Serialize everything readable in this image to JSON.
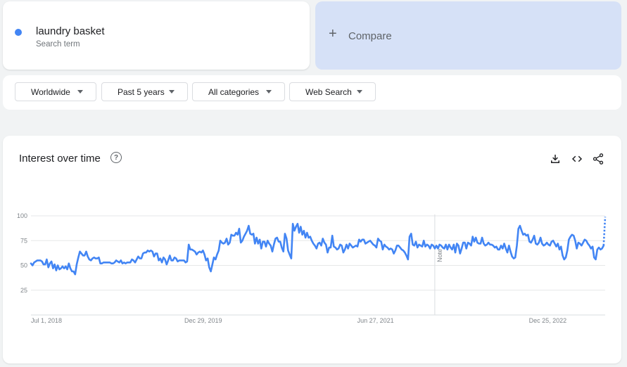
{
  "term": {
    "name": "laundry basket",
    "subtitle": "Search term",
    "color": "#4285f4"
  },
  "compare": {
    "plus": "+",
    "label": "Compare",
    "bg_color": "#d6e1f7"
  },
  "filters": [
    {
      "label": "Worldwide"
    },
    {
      "label": "Past 5 years"
    },
    {
      "label": "All categories"
    },
    {
      "label": "Web Search"
    }
  ],
  "chart_panel": {
    "title": "Interest over time",
    "help_icon": "?",
    "download_icon": "download-icon",
    "embed_icon": "embed-code-icon",
    "share_icon": "share-icon",
    "note_label": "Note"
  },
  "chart_data": {
    "type": "line",
    "title": "Interest over time",
    "xlabel": "",
    "ylabel": "",
    "ylim": [
      0,
      100
    ],
    "y_ticks": [
      100,
      75,
      50,
      25
    ],
    "x_range": [
      "2018-07-01",
      "2023-06-25"
    ],
    "x_ticks": [
      {
        "date": "2018-07-01",
        "label": "Jul 1, 2018"
      },
      {
        "date": "2019-12-29",
        "label": "Dec 29, 2019"
      },
      {
        "date": "2021-06-27",
        "label": "Jun 27, 2021"
      },
      {
        "date": "2022-12-25",
        "label": "Dec 25, 2022"
      }
    ],
    "note_date": "2022-01-01",
    "grid": true,
    "legend": "none",
    "line_color": "#4285f4",
    "partial_last_point": true,
    "series": [
      {
        "name": "laundry basket",
        "start": "2018-07-01",
        "interval": "week",
        "values": [
          52,
          50,
          53,
          54,
          55,
          55,
          55,
          54,
          51,
          51,
          56,
          48,
          52,
          54,
          47,
          51,
          45,
          50,
          46,
          47,
          49,
          47,
          49,
          46,
          52,
          47,
          44,
          44,
          41,
          51,
          58,
          64,
          62,
          60,
          60,
          64,
          59,
          56,
          55,
          57,
          58,
          57,
          57,
          58,
          52,
          52,
          53,
          53,
          53,
          53,
          53,
          52,
          52,
          53,
          55,
          54,
          53,
          55,
          52,
          53,
          52,
          53,
          53,
          53,
          56,
          55,
          53,
          56,
          59,
          57,
          57,
          62,
          63,
          63,
          65,
          64,
          65,
          64,
          59,
          62,
          62,
          55,
          57,
          53,
          58,
          56,
          51,
          55,
          60,
          55,
          55,
          58,
          57,
          54,
          55,
          55,
          55,
          55,
          53,
          54,
          71,
          66,
          66,
          65,
          64,
          61,
          63,
          64,
          63,
          65,
          61,
          55,
          57,
          48,
          44,
          51,
          58,
          56,
          61,
          65,
          75,
          73,
          72,
          73,
          77,
          71,
          73,
          81,
          80,
          80,
          83,
          81,
          87,
          73,
          75,
          79,
          82,
          85,
          90,
          82,
          81,
          82,
          72,
          78,
          72,
          76,
          67,
          74,
          74,
          69,
          75,
          72,
          70,
          64,
          71,
          77,
          78,
          74,
          74,
          68,
          64,
          82,
          77,
          65,
          61,
          57,
          92,
          85,
          89,
          92,
          83,
          89,
          81,
          85,
          78,
          83,
          78,
          79,
          75,
          72,
          70,
          67,
          72,
          73,
          70,
          77,
          73,
          71,
          63,
          68,
          68,
          80,
          69,
          68,
          66,
          67,
          71,
          70,
          63,
          66,
          71,
          67,
          72,
          70,
          68,
          69,
          70,
          69,
          76,
          74,
          76,
          76,
          72,
          73,
          74,
          75,
          73,
          71,
          70,
          68,
          77,
          75,
          74,
          66,
          71,
          69,
          68,
          66,
          67,
          66,
          62,
          65,
          70,
          70,
          68,
          66,
          65,
          63,
          60,
          56,
          79,
          82,
          71,
          70,
          74,
          68,
          71,
          70,
          69,
          75,
          69,
          71,
          70,
          67,
          71,
          70,
          67,
          70,
          67,
          71,
          70,
          68,
          67,
          71,
          66,
          71,
          68,
          66,
          71,
          63,
          72,
          70,
          62,
          67,
          73,
          73,
          67,
          73,
          72,
          70,
          79,
          74,
          78,
          73,
          72,
          72,
          78,
          72,
          70,
          71,
          73,
          71,
          71,
          70,
          68,
          69,
          66,
          66,
          70,
          67,
          72,
          67,
          63,
          70,
          64,
          59,
          57,
          58,
          70,
          87,
          90,
          85,
          81,
          82,
          80,
          81,
          74,
          73,
          76,
          80,
          72,
          71,
          73,
          78,
          72,
          70,
          71,
          73,
          71,
          70,
          74,
          75,
          72,
          69,
          72,
          66,
          69,
          60,
          56,
          58,
          65,
          76,
          79,
          81,
          80,
          75,
          67,
          73,
          72,
          70,
          73,
          76,
          75,
          72,
          70,
          67,
          69,
          58,
          56,
          66,
          68,
          66,
          67,
          70,
          99
        ]
      }
    ]
  }
}
